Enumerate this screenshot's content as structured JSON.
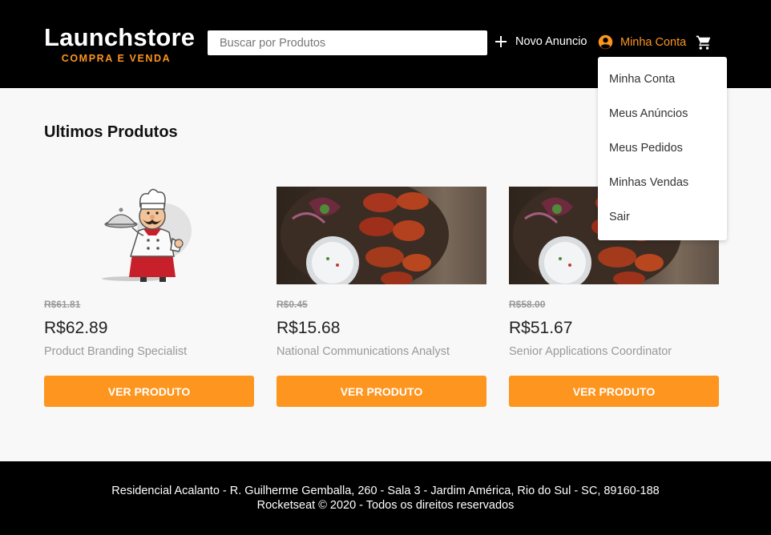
{
  "header": {
    "logo_title": "Launchstore",
    "logo_subtitle": "COMPRA E VENDA",
    "search_placeholder": "Buscar por Produtos",
    "new_ad_label": "Novo Anuncio",
    "account_label": "Minha Conta",
    "colors": {
      "background": "#000000",
      "accent": "#fd951f"
    },
    "icons": [
      "plus-icon",
      "account-circle-icon",
      "shopping-cart-icon"
    ]
  },
  "dropdown": {
    "items": [
      {
        "label": "Minha Conta"
      },
      {
        "label": "Meus Anúncios"
      },
      {
        "label": "Meus Pedidos"
      },
      {
        "label": "Minhas Vendas"
      },
      {
        "label": "Sair"
      }
    ]
  },
  "main": {
    "title": "Ultimos Produtos",
    "products": [
      {
        "old_price": "R$61.81",
        "price": "R$62.89",
        "name": "Product Branding Specialist",
        "button": "VER PRODUTO",
        "image": "chef-illustration"
      },
      {
        "old_price": "R$0.45",
        "price": "R$15.68",
        "name": "National Communications Analyst",
        "button": "VER PRODUTO",
        "image": "chicken-wings-photo"
      },
      {
        "old_price": "R$58.00",
        "price": "R$51.67",
        "name": "Senior Applications Coordinator",
        "button": "VER PRODUTO",
        "image": "chicken-wings-photo"
      }
    ]
  },
  "footer": {
    "address": "Residencial Acalanto - R. Guilherme Gemballa, 260 - Sala 3 - Jardim América, Rio do Sul - SC, 89160-188",
    "copyright": "Rocketseat © 2020 - Todos os direitos reservados"
  }
}
